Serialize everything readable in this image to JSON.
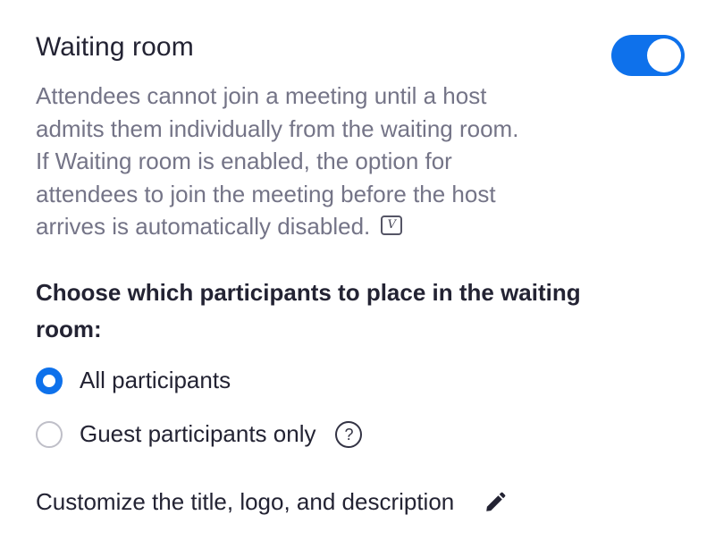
{
  "setting": {
    "title": "Waiting room",
    "enabled": true,
    "description_lines": [
      "Attendees cannot join a meeting until a host",
      "admits them individually from the waiting room.",
      "If Waiting room is enabled, the option for",
      "attendees to join the meeting before the host",
      "arrives is automatically disabled."
    ],
    "badge": "V"
  },
  "placement": {
    "heading": "Choose which participants to place in the waiting room:",
    "options": [
      {
        "label": "All participants",
        "selected": true
      },
      {
        "label": "Guest participants only",
        "selected": false
      }
    ],
    "help_icon": "?"
  },
  "customize": {
    "label": "Customize the title, logo, and description"
  },
  "colors": {
    "accent": "#0e71eb",
    "text": "#232333",
    "muted": "#747487"
  },
  "icons": {
    "help": "question-circle-icon",
    "edit": "pencil-icon",
    "badge": "v-badge-icon"
  }
}
